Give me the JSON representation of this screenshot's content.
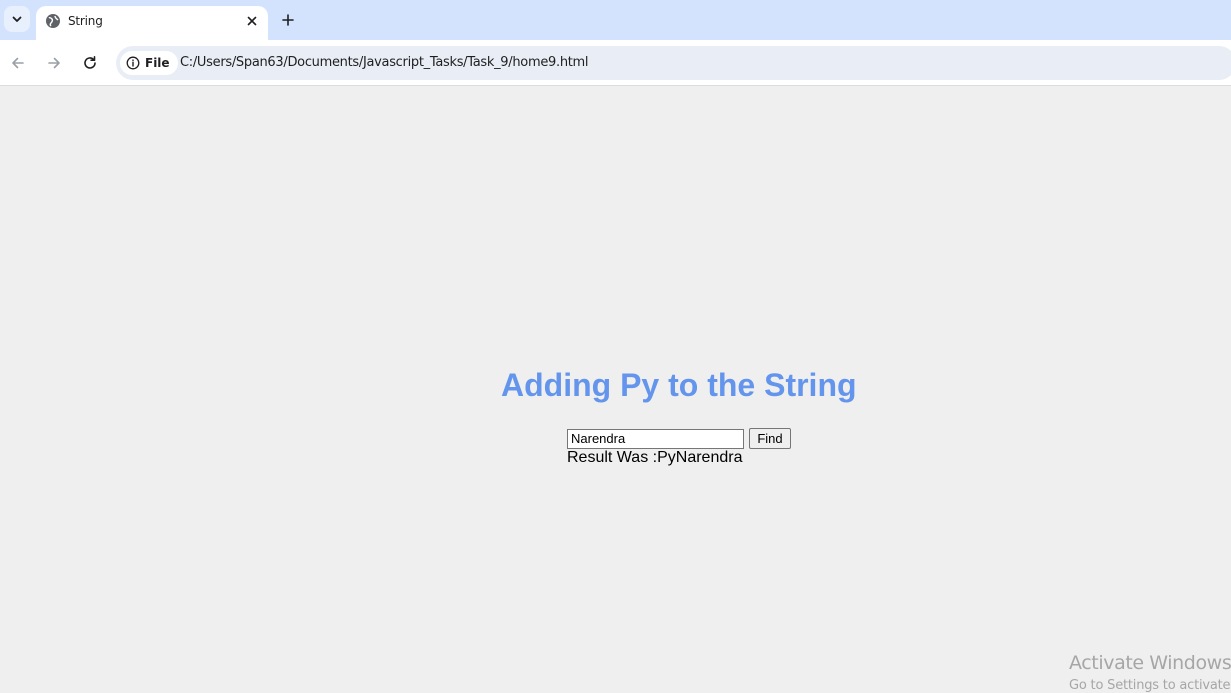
{
  "browser": {
    "tab": {
      "title": "String",
      "favicon": "globe-icon"
    },
    "address_bar": {
      "chip_label": "File",
      "url": "C:/Users/Span63/Documents/Javascript_Tasks/Task_9/home9.html"
    },
    "icons": {
      "tab_search": "chevron-down-icon",
      "close": "close-icon",
      "new_tab": "plus-icon",
      "back": "arrow-left-icon",
      "forward": "arrow-right-icon",
      "reload": "reload-icon",
      "site_info": "info-icon"
    },
    "colors": {
      "tabstrip": "#d3e3fd",
      "omnibox": "#e9eef6"
    }
  },
  "page": {
    "heading": "Adding Py to the String",
    "input_value": "Narendra",
    "button_label": "Find",
    "result_text": "Result Was :PyNarendra",
    "colors": {
      "heading": "#6495ed",
      "background": "#efefef"
    }
  },
  "os_watermark": {
    "title": "Activate Windows",
    "subtitle": "Go to Settings to activate"
  }
}
